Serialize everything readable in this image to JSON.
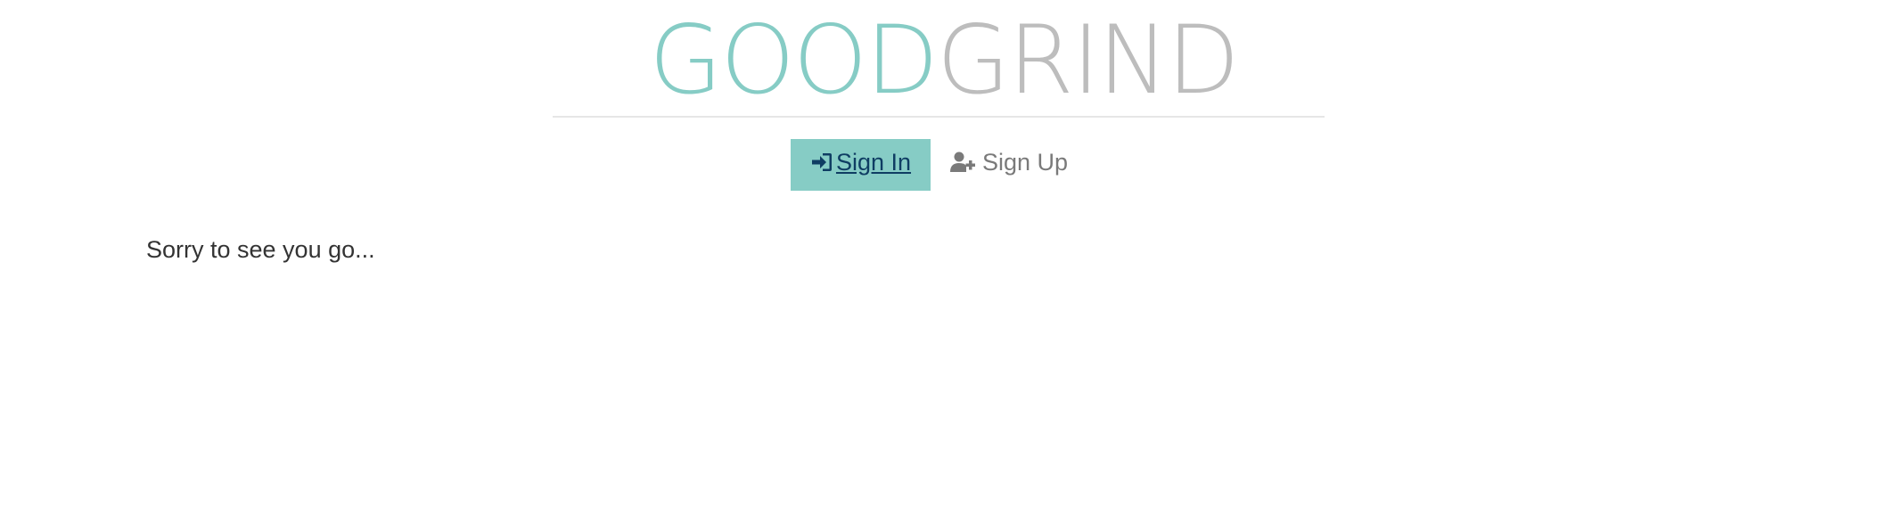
{
  "logo": {
    "part1": "GOOD",
    "part2": "GRIND",
    "colors": {
      "part1": "#86ccc5",
      "part2": "#bdbdbd"
    }
  },
  "nav": {
    "signin": {
      "label": " Sign In",
      "icon": "sign-in-icon",
      "active": true
    },
    "signup": {
      "label": " Sign Up",
      "icon": "user-plus-icon",
      "active": false
    }
  },
  "main": {
    "message": "Sorry to see you go..."
  },
  "colors": {
    "accent": "#86ccc5",
    "active_link": "#0f3d63",
    "inactive_link": "#7a7a7a",
    "text": "#333333"
  }
}
